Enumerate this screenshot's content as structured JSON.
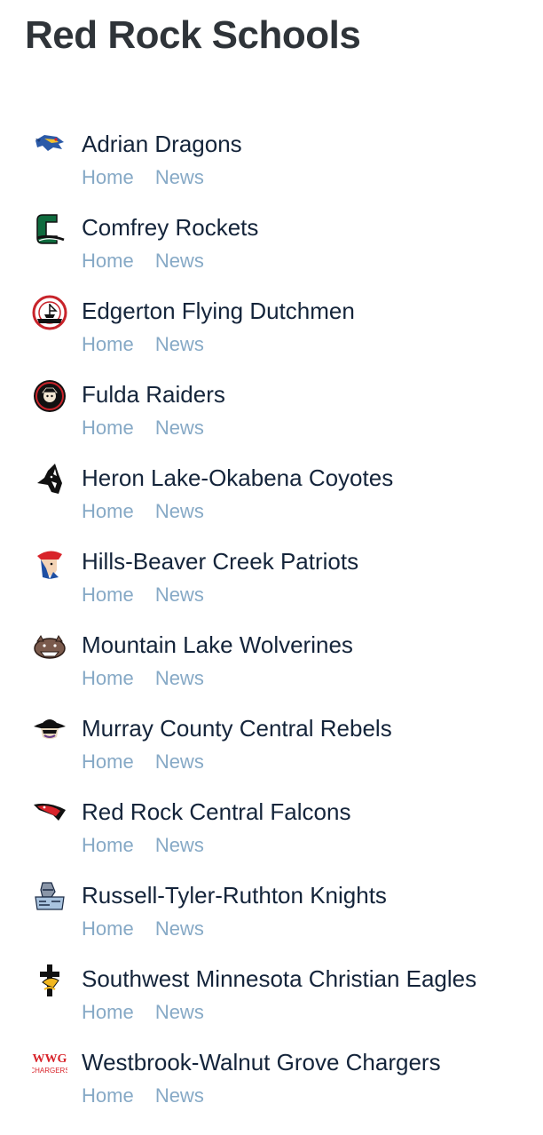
{
  "page_title": "Red Rock Schools",
  "colors": {
    "title": "#2f3439",
    "school_name": "#14243a",
    "link": "#86a9c6"
  },
  "schools": [
    {
      "name": "Adrian Dragons",
      "home_label": "Home",
      "news_label": "News",
      "logo_icon": "dragon-logo-icon"
    },
    {
      "name": "Comfrey Rockets",
      "home_label": "Home",
      "news_label": "News",
      "logo_icon": "rockets-logo-icon"
    },
    {
      "name": "Edgerton Flying Dutchmen",
      "home_label": "Home",
      "news_label": "News",
      "logo_icon": "flying-dutchmen-logo-icon"
    },
    {
      "name": "Fulda Raiders",
      "home_label": "Home",
      "news_label": "News",
      "logo_icon": "raiders-logo-icon"
    },
    {
      "name": "Heron Lake-Okabena Coyotes",
      "home_label": "Home",
      "news_label": "News",
      "logo_icon": "coyote-logo-icon"
    },
    {
      "name": "Hills-Beaver Creek Patriots",
      "home_label": "Home",
      "news_label": "News",
      "logo_icon": "patriot-logo-icon"
    },
    {
      "name": "Mountain Lake Wolverines",
      "home_label": "Home",
      "news_label": "News",
      "logo_icon": "wolverine-logo-icon"
    },
    {
      "name": "Murray County Central Rebels",
      "home_label": "Home",
      "news_label": "News",
      "logo_icon": "rebel-logo-icon"
    },
    {
      "name": "Red Rock Central Falcons",
      "home_label": "Home",
      "news_label": "News",
      "logo_icon": "falcon-logo-icon"
    },
    {
      "name": "Russell-Tyler-Ruthton Knights",
      "home_label": "Home",
      "news_label": "News",
      "logo_icon": "knight-logo-icon"
    },
    {
      "name": "Southwest Minnesota Christian Eagles",
      "home_label": "Home",
      "news_label": "News",
      "logo_icon": "eagle-cross-logo-icon"
    },
    {
      "name": "Westbrook-Walnut Grove Chargers",
      "home_label": "Home",
      "news_label": "News",
      "logo_icon": "chargers-logo-icon",
      "logo_text": "WWG CHARGERS"
    }
  ]
}
